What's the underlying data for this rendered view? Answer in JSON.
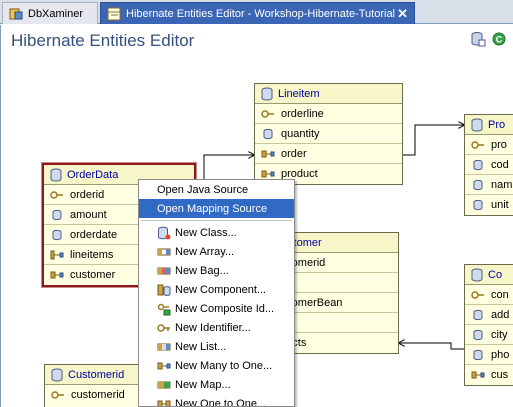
{
  "tabs": [
    {
      "label": "DbXaminer",
      "active": false
    },
    {
      "label": "Hibernate Entities Editor - Workshop-Hibernate-Tutorial",
      "active": true
    }
  ],
  "close_glyph": "✕",
  "editor": {
    "title": "Hibernate Entities Editor",
    "toolbar_icons": [
      "database-icon",
      "refresh-icon"
    ]
  },
  "entities": {
    "orderdata": {
      "name": "OrderData",
      "rows": [
        "orderid",
        "amount",
        "orderdate",
        "lineitems",
        "customer"
      ]
    },
    "lineitem": {
      "name": "Lineitem",
      "rows": [
        "orderline",
        "quantity",
        "order",
        "product"
      ]
    },
    "product": {
      "name": "Pro",
      "rows": [
        "pro",
        "cod",
        "nam",
        "unit"
      ]
    },
    "customer": {
      "name": "Customer",
      "rows": [
        "ustomerid",
        "me",
        "ustomerBean",
        "ers",
        "ntacts"
      ]
    },
    "contact": {
      "name": "Co",
      "rows": [
        "con",
        "add",
        "city",
        "pho",
        "cus"
      ]
    },
    "customerid": {
      "name": "Customerid",
      "rows": [
        "customerid",
        ""
      ]
    }
  },
  "context_menu": {
    "items": [
      {
        "label": "Open Java Source",
        "highlighted": false
      },
      {
        "label": "Open Mapping Source",
        "highlighted": true
      },
      {
        "label": "New Class...",
        "icon": "class-icon"
      },
      {
        "label": "New Array...",
        "icon": "array-icon"
      },
      {
        "label": "New Bag...",
        "icon": "bag-icon"
      },
      {
        "label": "New Component...",
        "icon": "component-icon"
      },
      {
        "label": "New Composite Id...",
        "icon": "composite-id-icon"
      },
      {
        "label": "New Identifier...",
        "icon": "identifier-icon"
      },
      {
        "label": "New List...",
        "icon": "list-icon"
      },
      {
        "label": "New Many to One...",
        "icon": "many-to-one-icon"
      },
      {
        "label": "New Map...",
        "icon": "map-icon"
      },
      {
        "label": "New One to One...",
        "icon": "one-to-one-icon"
      }
    ]
  },
  "colors": {
    "accent": "#3b66b5",
    "menu_highlight": "#316ac5",
    "entity_fill": "#ffffe1",
    "entity_title": "#0000a0",
    "editor_title": "#35517e",
    "selected_border": "#8b1a1a"
  }
}
